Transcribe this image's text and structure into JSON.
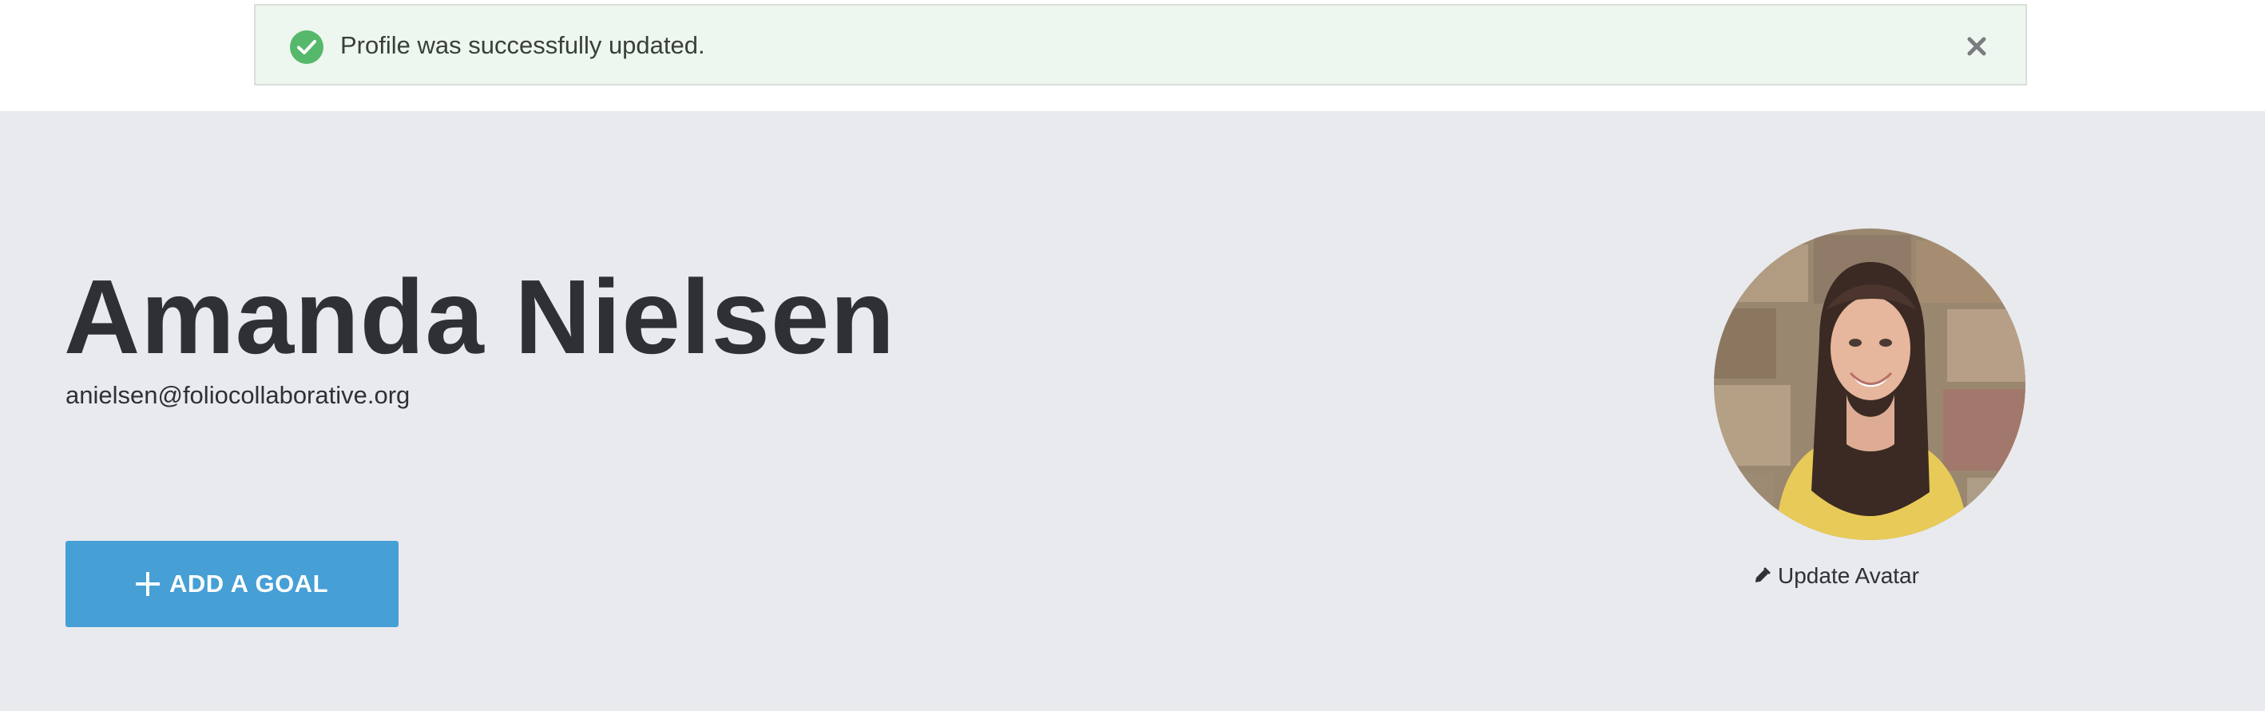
{
  "alert": {
    "message": "Profile was successfully updated.",
    "status": "success",
    "icon": "check-circle-icon",
    "close_icon": "close-icon",
    "colors": {
      "background": "#eef7ef",
      "icon": "#56b86a"
    }
  },
  "profile": {
    "name": "Amanda Nielsen",
    "email": "anielsen@foliocollaborative.org",
    "avatar_icon": "profile-photo",
    "update_avatar_label": "Update Avatar",
    "update_avatar_icon": "pencil-icon"
  },
  "actions": {
    "add_goal_label": "ADD A GOAL",
    "add_goal_icon": "plus-icon"
  },
  "colors": {
    "hero_background": "#e9eaee",
    "primary_button": "#469fd5",
    "text": "#2f3033"
  }
}
